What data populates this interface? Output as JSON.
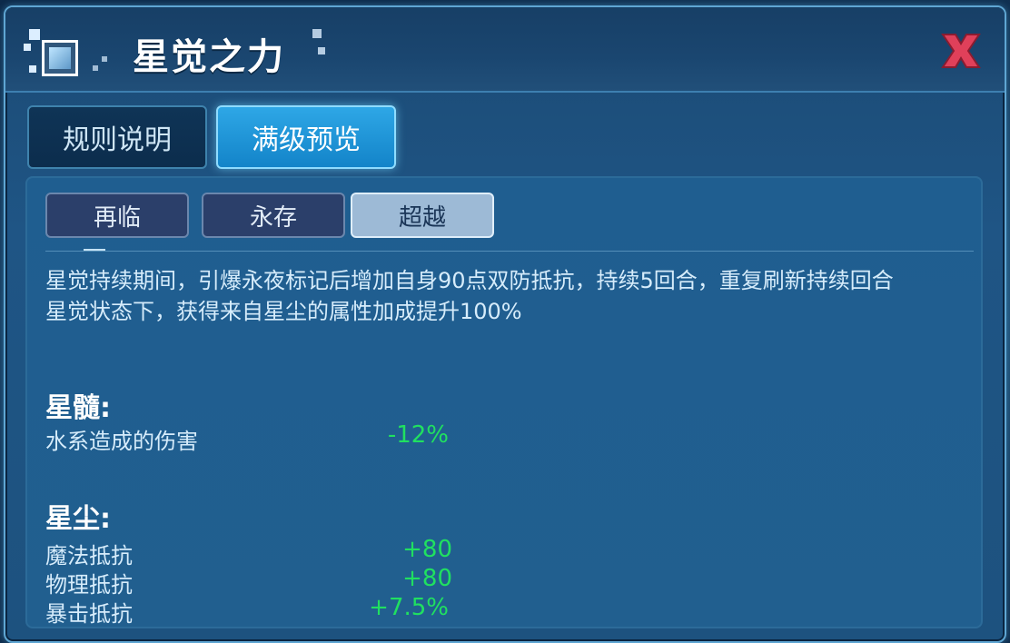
{
  "window": {
    "title": "星觉之力"
  },
  "tabs": [
    {
      "label": "规则说明",
      "active": false
    },
    {
      "label": "满级预览",
      "active": true
    }
  ],
  "subtabs": [
    {
      "label": "再临",
      "active": false
    },
    {
      "label": "永存",
      "active": false
    },
    {
      "label": "超越",
      "active": true
    }
  ],
  "description": {
    "line1": "星觉持续期间，引爆永夜标记后增加自身90点双防抵抗，持续5回合，重复刷新持续回合",
    "line2": "星觉状态下，获得来自星尘的属性加成提升100%"
  },
  "section_marrow": {
    "title": "星髓:",
    "stats": [
      {
        "label": "水系造成的伤害",
        "value": "-12%"
      }
    ]
  },
  "section_dust": {
    "title": "星尘:",
    "stats": [
      {
        "label": "魔法抵抗",
        "value": "+80"
      },
      {
        "label": "物理抵抗",
        "value": "+80"
      },
      {
        "label": "暴击抵抗",
        "value": "+7.5%"
      }
    ]
  },
  "icons": {
    "close": "close-x-icon",
    "emblem": "star-emblem-icon"
  },
  "colors": {
    "positive": "#20e060",
    "close": "#e0405a",
    "accent": "#2ea7e6"
  }
}
